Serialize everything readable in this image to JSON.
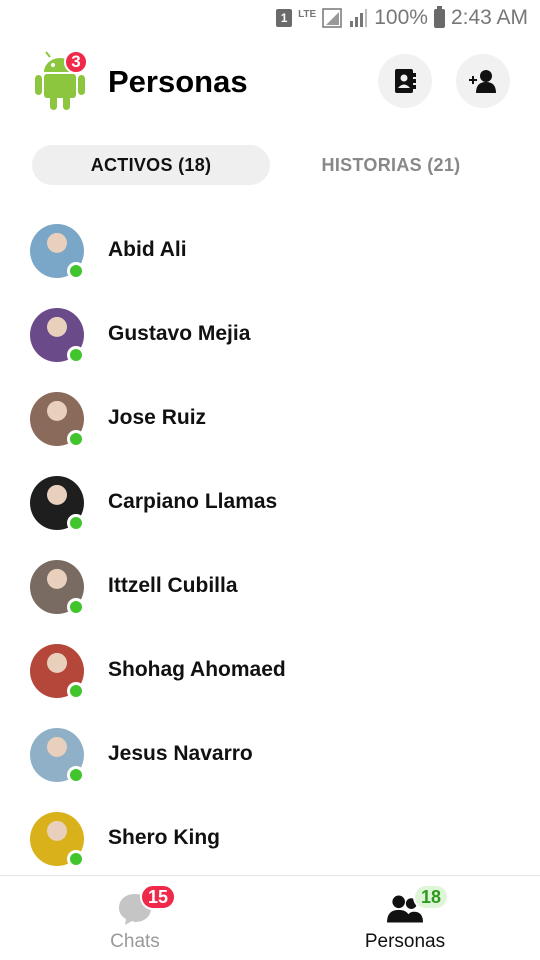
{
  "status_bar": {
    "sim_slot": "1",
    "network": "LTE",
    "battery": "100%",
    "time": "2:43 AM"
  },
  "header": {
    "title": "Personas",
    "logo_badge": "3",
    "contacts_button_icon": "contacts-book-icon",
    "add_person_button_icon": "add-person-icon"
  },
  "tabs": {
    "active": "ACTIVOS (18)",
    "stories": "HISTORIAS (21)"
  },
  "people": [
    {
      "name": "Abid Ali",
      "online": true,
      "avatar_color": "#7aa7c7"
    },
    {
      "name": "Gustavo Mejia",
      "online": true,
      "avatar_color": "#6b4a8a"
    },
    {
      "name": "Jose Ruiz",
      "online": true,
      "avatar_color": "#8a6a5a"
    },
    {
      "name": "Carpiano Llamas",
      "online": true,
      "avatar_color": "#1e1e1e"
    },
    {
      "name": "Ittzell Cubilla",
      "online": true,
      "avatar_color": "#7a6b62"
    },
    {
      "name": "Shohag Ahomaed",
      "online": true,
      "avatar_color": "#b4473a"
    },
    {
      "name": "Jesus Navarro",
      "online": true,
      "avatar_color": "#8fb0c7"
    },
    {
      "name": "Shero King",
      "online": true,
      "avatar_color": "#d9b21b"
    }
  ],
  "bottom_nav": {
    "chats_label": "Chats",
    "chats_badge": "15",
    "people_label": "Personas",
    "people_badge": "18"
  },
  "colors": {
    "online": "#42c42c",
    "badge_red": "#f0284a",
    "badge_green_bg": "#dff5d7",
    "badge_green_text": "#2c9a1e",
    "android_green": "#8cc63f"
  }
}
